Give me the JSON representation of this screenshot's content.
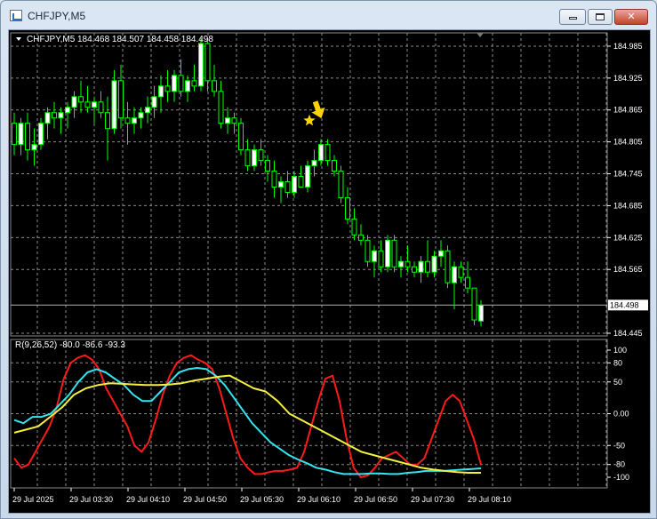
{
  "window": {
    "title": "CHFJPY,M5",
    "buttons": {
      "minimize": "",
      "maximize": "",
      "close": "✕"
    }
  },
  "main_chart": {
    "symbol": "CHFJPY,M5",
    "ohlc": "184.468 184.507 184.458 184.498",
    "current_price": "184.498",
    "price_labels": [
      "184.985",
      "184.925",
      "184.865",
      "184.805",
      "184.745",
      "184.685",
      "184.625",
      "184.565",
      "184.445"
    ],
    "colors": {
      "bull": "#ffffff",
      "bear": "#000000",
      "wick": "#00ff00",
      "grid": "#8a8a8a",
      "star": "#ffd400",
      "arrow": "#ffd400"
    }
  },
  "indicator": {
    "label": "R(9,26,52) -80.0 -86.6 -93.3",
    "level_labels": [
      "100",
      "80",
      "50",
      "0.00",
      "-50",
      "-80",
      "-100"
    ],
    "colors": {
      "fast": "#ff1a1a",
      "mid": "#33e5f0",
      "slow": "#f5f03c"
    }
  },
  "time_labels": [
    "29 Jul 2025",
    "29 Jul 03:30",
    "29 Jul 04:10",
    "29 Jul 04:50",
    "29 Jul 05:30",
    "29 Jul 06:10",
    "29 Jul 06:50",
    "29 Jul 07:30",
    "29 Jul 08:10"
  ],
  "chart_data": [
    {
      "type": "candlestick",
      "title": "CHFJPY,M5",
      "ylim": [
        184.44,
        185.01
      ],
      "candles": [
        {
          "o": 184.84,
          "h": 184.86,
          "l": 184.78,
          "c": 184.8
        },
        {
          "o": 184.8,
          "h": 184.85,
          "l": 184.78,
          "c": 184.84
        },
        {
          "o": 184.84,
          "h": 184.86,
          "l": 184.77,
          "c": 184.79
        },
        {
          "o": 184.79,
          "h": 184.83,
          "l": 184.76,
          "c": 184.8
        },
        {
          "o": 184.8,
          "h": 184.85,
          "l": 184.79,
          "c": 184.84
        },
        {
          "o": 184.84,
          "h": 184.87,
          "l": 184.81,
          "c": 184.86
        },
        {
          "o": 184.86,
          "h": 184.88,
          "l": 184.83,
          "c": 184.85
        },
        {
          "o": 184.85,
          "h": 184.87,
          "l": 184.82,
          "c": 184.86
        },
        {
          "o": 184.86,
          "h": 184.88,
          "l": 184.83,
          "c": 184.87
        },
        {
          "o": 184.87,
          "h": 184.9,
          "l": 184.85,
          "c": 184.89
        },
        {
          "o": 184.89,
          "h": 184.92,
          "l": 184.86,
          "c": 184.88
        },
        {
          "o": 184.88,
          "h": 184.91,
          "l": 184.86,
          "c": 184.87
        },
        {
          "o": 184.87,
          "h": 184.89,
          "l": 184.84,
          "c": 184.88
        },
        {
          "o": 184.88,
          "h": 184.9,
          "l": 184.85,
          "c": 184.86
        },
        {
          "o": 184.86,
          "h": 184.89,
          "l": 184.77,
          "c": 184.83
        },
        {
          "o": 184.83,
          "h": 184.94,
          "l": 184.82,
          "c": 184.92
        },
        {
          "o": 184.92,
          "h": 184.95,
          "l": 184.83,
          "c": 184.85
        },
        {
          "o": 184.85,
          "h": 184.88,
          "l": 184.8,
          "c": 184.84
        },
        {
          "o": 184.84,
          "h": 184.87,
          "l": 184.82,
          "c": 184.85
        },
        {
          "o": 184.85,
          "h": 184.87,
          "l": 184.83,
          "c": 184.86
        },
        {
          "o": 184.86,
          "h": 184.89,
          "l": 184.84,
          "c": 184.87
        },
        {
          "o": 184.87,
          "h": 184.91,
          "l": 184.85,
          "c": 184.89
        },
        {
          "o": 184.89,
          "h": 184.93,
          "l": 184.86,
          "c": 184.91
        },
        {
          "o": 184.91,
          "h": 184.94,
          "l": 184.88,
          "c": 184.9
        },
        {
          "o": 184.9,
          "h": 184.94,
          "l": 184.88,
          "c": 184.93
        },
        {
          "o": 184.93,
          "h": 184.96,
          "l": 184.89,
          "c": 184.9
        },
        {
          "o": 184.9,
          "h": 184.93,
          "l": 184.88,
          "c": 184.92
        },
        {
          "o": 184.92,
          "h": 184.95,
          "l": 184.9,
          "c": 184.91
        },
        {
          "o": 184.91,
          "h": 185.0,
          "l": 184.9,
          "c": 184.99
        },
        {
          "o": 184.99,
          "h": 185.0,
          "l": 184.9,
          "c": 184.92
        },
        {
          "o": 184.92,
          "h": 184.95,
          "l": 184.89,
          "c": 184.9
        },
        {
          "o": 184.9,
          "h": 184.92,
          "l": 184.83,
          "c": 184.84
        },
        {
          "o": 184.84,
          "h": 184.87,
          "l": 184.82,
          "c": 184.85
        },
        {
          "o": 184.85,
          "h": 184.86,
          "l": 184.82,
          "c": 184.84
        },
        {
          "o": 184.84,
          "h": 184.85,
          "l": 184.78,
          "c": 184.79
        },
        {
          "o": 184.79,
          "h": 184.81,
          "l": 184.75,
          "c": 184.76
        },
        {
          "o": 184.76,
          "h": 184.8,
          "l": 184.75,
          "c": 184.79
        },
        {
          "o": 184.79,
          "h": 184.81,
          "l": 184.76,
          "c": 184.77
        },
        {
          "o": 184.77,
          "h": 184.78,
          "l": 184.73,
          "c": 184.75
        },
        {
          "o": 184.75,
          "h": 184.77,
          "l": 184.7,
          "c": 184.72
        },
        {
          "o": 184.72,
          "h": 184.74,
          "l": 184.69,
          "c": 184.73
        },
        {
          "o": 184.73,
          "h": 184.75,
          "l": 184.7,
          "c": 184.71
        },
        {
          "o": 184.71,
          "h": 184.75,
          "l": 184.7,
          "c": 184.74
        },
        {
          "o": 184.74,
          "h": 184.76,
          "l": 184.72,
          "c": 184.72
        },
        {
          "o": 184.72,
          "h": 184.77,
          "l": 184.71,
          "c": 184.76
        },
        {
          "o": 184.76,
          "h": 184.79,
          "l": 184.74,
          "c": 184.77
        },
        {
          "o": 184.77,
          "h": 184.81,
          "l": 184.76,
          "c": 184.8
        },
        {
          "o": 184.8,
          "h": 184.81,
          "l": 184.76,
          "c": 184.77
        },
        {
          "o": 184.77,
          "h": 184.78,
          "l": 184.74,
          "c": 184.75
        },
        {
          "o": 184.75,
          "h": 184.76,
          "l": 184.69,
          "c": 184.7
        },
        {
          "o": 184.7,
          "h": 184.72,
          "l": 184.65,
          "c": 184.66
        },
        {
          "o": 184.66,
          "h": 184.68,
          "l": 184.62,
          "c": 184.63
        },
        {
          "o": 184.63,
          "h": 184.65,
          "l": 184.61,
          "c": 184.62
        },
        {
          "o": 184.62,
          "h": 184.63,
          "l": 184.57,
          "c": 184.58
        },
        {
          "o": 184.58,
          "h": 184.61,
          "l": 184.55,
          "c": 184.6
        },
        {
          "o": 184.6,
          "h": 184.62,
          "l": 184.56,
          "c": 184.57
        },
        {
          "o": 184.57,
          "h": 184.63,
          "l": 184.56,
          "c": 184.62
        },
        {
          "o": 184.62,
          "h": 184.63,
          "l": 184.56,
          "c": 184.57
        },
        {
          "o": 184.57,
          "h": 184.59,
          "l": 184.55,
          "c": 184.58
        },
        {
          "o": 184.58,
          "h": 184.61,
          "l": 184.56,
          "c": 184.57
        },
        {
          "o": 184.57,
          "h": 184.58,
          "l": 184.55,
          "c": 184.56
        },
        {
          "o": 184.56,
          "h": 184.59,
          "l": 184.54,
          "c": 184.58
        },
        {
          "o": 184.58,
          "h": 184.62,
          "l": 184.55,
          "c": 184.56
        },
        {
          "o": 184.56,
          "h": 184.6,
          "l": 184.55,
          "c": 184.59
        },
        {
          "o": 184.59,
          "h": 184.62,
          "l": 184.57,
          "c": 184.6
        },
        {
          "o": 184.6,
          "h": 184.61,
          "l": 184.53,
          "c": 184.54
        },
        {
          "o": 184.54,
          "h": 184.58,
          "l": 184.49,
          "c": 184.57
        },
        {
          "o": 184.57,
          "h": 184.58,
          "l": 184.54,
          "c": 184.55
        },
        {
          "o": 184.55,
          "h": 184.58,
          "l": 184.52,
          "c": 184.53
        },
        {
          "o": 184.53,
          "h": 184.53,
          "l": 184.46,
          "c": 184.47
        },
        {
          "o": 184.468,
          "h": 184.507,
          "l": 184.458,
          "c": 184.498
        }
      ]
    },
    {
      "type": "line",
      "title": "R(9,26,52)",
      "ylim": [
        -100,
        100
      ],
      "series": [
        {
          "name": "",
          "values": [
            -70,
            -85,
            -80,
            -60,
            -40,
            -20,
            10,
            55,
            80,
            88,
            92,
            85,
            70,
            40,
            20,
            0,
            -20,
            -50,
            -60,
            -45,
            -10,
            30,
            60,
            80,
            88,
            92,
            85,
            80,
            70,
            40,
            0,
            -40,
            -70,
            -85,
            -95,
            -95,
            -92,
            -90,
            -90,
            -88,
            -85,
            -60,
            -20,
            20,
            55,
            60,
            20,
            -40,
            -85,
            -100,
            -97,
            -85,
            -70,
            -65,
            -60,
            -70,
            -80,
            -80,
            -70,
            -40,
            -10,
            20,
            30,
            20,
            -10,
            -40,
            -80
          ]
        },
        {
          "name": "",
          "values": [
            -10,
            -15,
            -5,
            -5,
            0,
            15,
            30,
            50,
            65,
            70,
            65,
            55,
            45,
            30,
            20,
            20,
            35,
            50,
            65,
            70,
            72,
            70,
            60,
            45,
            25,
            5,
            -15,
            -30,
            -45,
            -55,
            -65,
            -72,
            -78,
            -85,
            -88,
            -92,
            -95,
            -95,
            -95,
            -94,
            -94,
            -95,
            -95,
            -93,
            -92,
            -90,
            -90,
            -90,
            -89,
            -88,
            -87,
            -86
          ]
        },
        {
          "name": "",
          "values": [
            -30,
            -25,
            -20,
            -5,
            10,
            30,
            40,
            45,
            48,
            47,
            46,
            45,
            45,
            46,
            48,
            52,
            55,
            58,
            60,
            50,
            40,
            35,
            20,
            0,
            -10,
            -20,
            -30,
            -40,
            -50,
            -60,
            -65,
            -70,
            -75,
            -80,
            -85,
            -88,
            -90,
            -92,
            -93,
            -93
          ]
        }
      ]
    }
  ]
}
